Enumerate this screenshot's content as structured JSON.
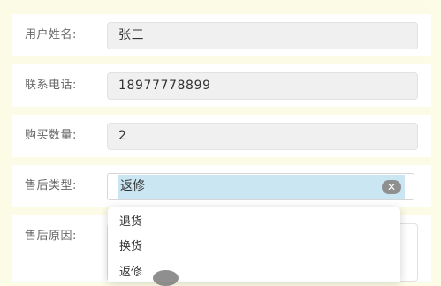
{
  "form": {
    "name": {
      "label": "用户姓名:",
      "value": "张三"
    },
    "phone": {
      "label": "联系电话:",
      "value": "18977778899"
    },
    "quantity": {
      "label": "购买数量:",
      "value": "2"
    },
    "service_type": {
      "label": "售后类型:",
      "selected": "返修",
      "options": [
        "退货",
        "换货",
        "返修"
      ]
    },
    "reason": {
      "label": "售后原因:",
      "value": ""
    }
  },
  "icons": {
    "clear": "clear-circle-icon",
    "cursor": "pointer-cursor-icon"
  },
  "colors": {
    "page_background": "#fdfde7",
    "selected_option_highlight": "#c9e6f2",
    "field_background": "#f0f0f0"
  }
}
